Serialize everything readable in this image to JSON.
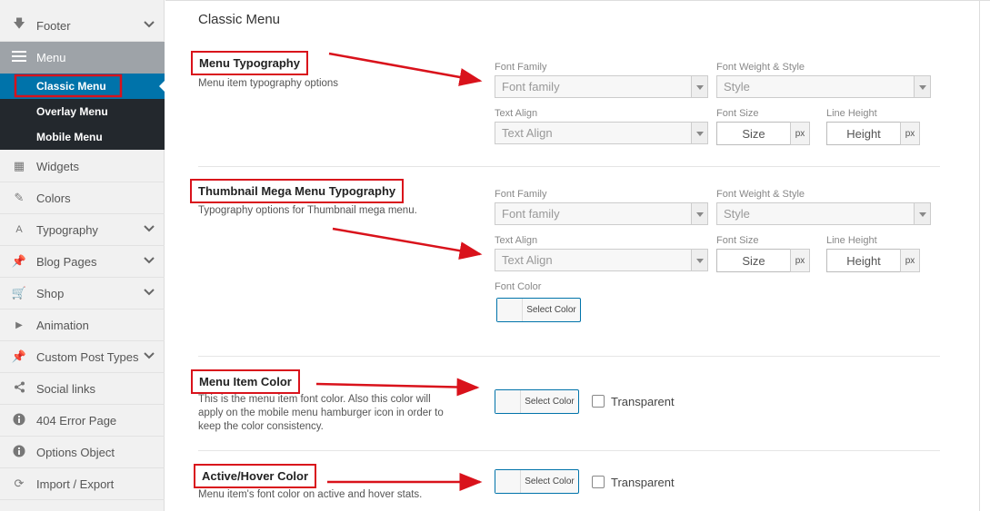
{
  "sidebar": {
    "items": [
      {
        "label": "Footer",
        "icon": "arrow-down-icon",
        "chevron": true
      },
      {
        "label": "Menu",
        "icon": "menu-icon",
        "chevron": false,
        "active": true
      },
      {
        "label": "Widgets",
        "icon": "widgets-icon",
        "chevron": false
      },
      {
        "label": "Colors",
        "icon": "brush-icon",
        "chevron": false
      },
      {
        "label": "Typography",
        "icon": "typography-icon",
        "chevron": true
      },
      {
        "label": "Blog Pages",
        "icon": "pin-icon",
        "chevron": true
      },
      {
        "label": "Shop",
        "icon": "cart-icon",
        "chevron": true
      },
      {
        "label": "Animation",
        "icon": "play-icon",
        "chevron": false
      },
      {
        "label": "Custom Post Types",
        "icon": "pin-icon",
        "chevron": true
      },
      {
        "label": "Social links",
        "icon": "share-icon",
        "chevron": false
      },
      {
        "label": "404 Error Page",
        "icon": "info-icon",
        "chevron": false
      },
      {
        "label": "Options Object",
        "icon": "info-icon",
        "chevron": false
      },
      {
        "label": "Import / Export",
        "icon": "refresh-icon",
        "chevron": false
      }
    ],
    "submenu": [
      "Classic Menu",
      "Overlay Menu",
      "Mobile Menu"
    ]
  },
  "page": {
    "title": "Classic Menu"
  },
  "sections": {
    "menu_typography": {
      "title": "Menu Typography",
      "desc": "Menu item typography options"
    },
    "thumb_typography": {
      "title": "Thumbnail Mega Menu Typography",
      "desc": "Typography options for Thumbnail mega menu."
    },
    "item_color": {
      "title": "Menu Item Color",
      "desc_lines": [
        "This is the menu item font color. Also this color will",
        "apply on the mobile menu hamburger icon in order to",
        "keep the color consistency."
      ]
    },
    "active_color": {
      "title": "Active/Hover Color",
      "desc": "Menu item's font color on active and hover stats."
    }
  },
  "fields": {
    "font_family_label": "Font Family",
    "font_family_placeholder": "Font family",
    "font_weight_label": "Font Weight & Style",
    "font_weight_placeholder": "Style",
    "text_align_label": "Text Align",
    "text_align_placeholder": "Text Align",
    "font_size_label": "Font Size",
    "font_size_placeholder": "Size",
    "line_height_label": "Line Height",
    "line_height_placeholder": "Height",
    "unit": "px",
    "font_color_label": "Font Color",
    "select_color": "Select Color",
    "transparent": "Transparent"
  },
  "colors": {
    "accent": "#0073aa",
    "annotation": "#d9121b",
    "sidebar_dark": "#23282d"
  }
}
